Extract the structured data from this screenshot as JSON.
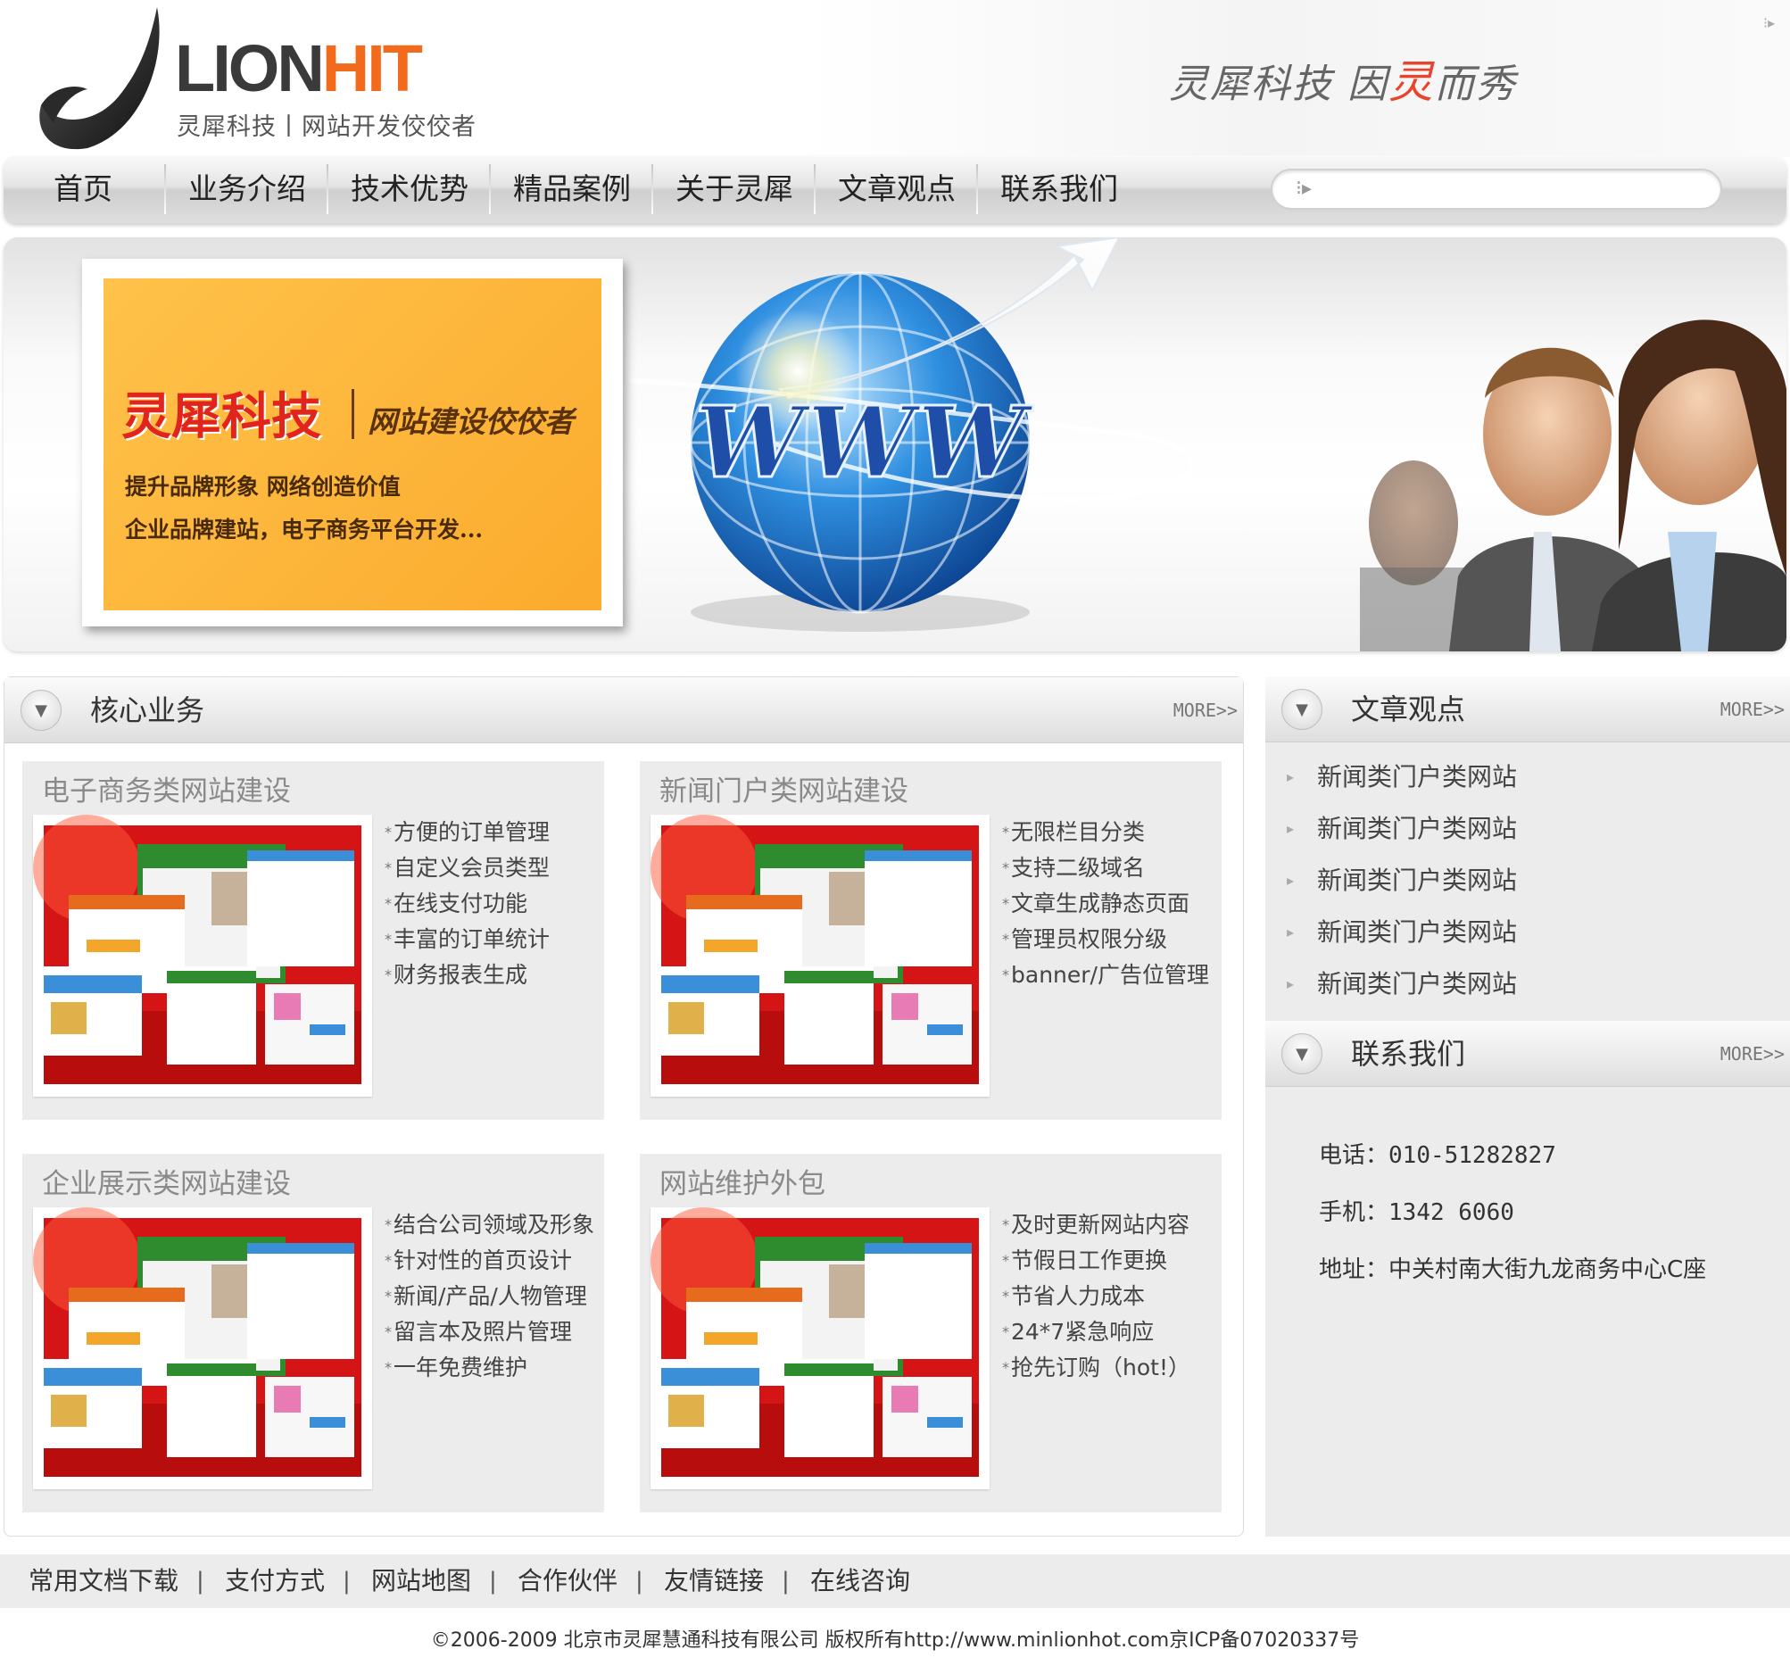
{
  "header": {
    "logo_primary": "LION",
    "logo_accent": "HIT",
    "logo_subtitle": "灵犀科技丨网站开发佼佼者",
    "slogan_part1": "灵犀科技 因",
    "slogan_accent": "灵",
    "slogan_part2": "而秀",
    "corner_icon": "arrow-right-dotted-icon"
  },
  "nav": {
    "items": [
      "首页",
      "业务介绍",
      "技术优势",
      "精品案例",
      "关于灵犀",
      "文章观点",
      "联系我们"
    ],
    "search_value": ""
  },
  "banner": {
    "promo_title": "灵犀科技",
    "promo_tagline": "网站建设佼佼者",
    "promo_line1": "提升品牌形象 网络创造价值",
    "promo_line2": "企业品牌建站，电子商务平台开发...",
    "globe_text": "WWW"
  },
  "core": {
    "title": "核心业务",
    "more": "MORE>>",
    "cards": [
      {
        "title": "电子商务类网站建设",
        "items": [
          "方便的订单管理",
          "自定义会员类型",
          "在线支付功能",
          "丰富的订单统计",
          "财务报表生成"
        ]
      },
      {
        "title": "新闻门户类网站建设",
        "items": [
          "无限栏目分类",
          "支持二级域名",
          "文章生成静态页面",
          "管理员权限分级",
          "banner/广告位管理"
        ]
      },
      {
        "title": "企业展示类网站建设",
        "items": [
          "结合公司领域及形象",
          "针对性的首页设计",
          "新闻/产品/人物管理",
          "留言本及照片管理",
          "一年免费维护"
        ]
      },
      {
        "title": "网站维护外包",
        "items": [
          "及时更新网站内容",
          "节假日工作更换",
          "节省人力成本",
          "24*7紧急响应",
          "抢先订购（hot!）"
        ]
      }
    ]
  },
  "articles": {
    "title": "文章观点",
    "more": "MORE>>",
    "items": [
      "新闻类门户类网站",
      "新闻类门户类网站",
      "新闻类门户类网站",
      "新闻类门户类网站",
      "新闻类门户类网站"
    ]
  },
  "contact": {
    "title": "联系我们",
    "more": "MORE>>",
    "phone_label": "电话：",
    "phone": "010-51282827",
    "mobile_label": "手机：",
    "mobile": "1342 6060",
    "address_label": "地址：",
    "address": "中关村南大街九龙商务中心C座"
  },
  "footer": {
    "links": [
      "常用文档下载",
      "支付方式",
      "网站地图",
      "合作伙伴",
      "友情链接",
      "在线咨询"
    ],
    "separator": "|",
    "copyright": "©2006-2009 北京市灵犀慧通科技有限公司 版权所有http://www.minlionhot.com京ICP备07020337号"
  },
  "colors": {
    "accent_orange": "#f26a1b",
    "promo_red": "#e2251c",
    "promo_yellow": "#fbab2d",
    "panel_gray": "#ececec"
  }
}
